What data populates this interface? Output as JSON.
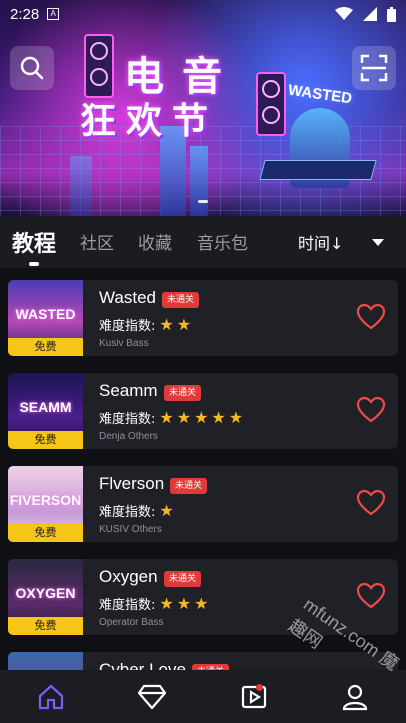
{
  "status_bar": {
    "time": "2:28",
    "notification_glyph": "A"
  },
  "banner": {
    "title_line1": "电音",
    "title_line2": "狂欢节",
    "sign_text": "WASTED",
    "dots_count": 1
  },
  "tabs": [
    {
      "label": "教程",
      "active": true
    },
    {
      "label": "社区",
      "active": false
    },
    {
      "label": "收藏",
      "active": false
    },
    {
      "label": "音乐包",
      "active": false
    }
  ],
  "sort": {
    "label": "时间↓"
  },
  "songs": [
    {
      "thumb_text": "WASTED",
      "free_label": "免费",
      "title": "Wasted",
      "badge": "未通关",
      "difficulty_label": "难度指数:",
      "stars": 2,
      "artist": "Kusiv",
      "genre": "Bass",
      "thumb_bg": "linear-gradient(180deg,#4b3bb5,#b54ab4 55%,#2a2470)"
    },
    {
      "thumb_text": "SEAMM",
      "free_label": "免费",
      "title": "Seamm",
      "badge": "未通关",
      "difficulty_label": "难度指数:",
      "stars": 5,
      "artist": "Denja",
      "genre": "Others",
      "thumb_bg": "linear-gradient(180deg,#1b1555,#4a1f8a 60%,#20124a)"
    },
    {
      "thumb_text": "FIVERSON",
      "free_label": "免费",
      "title": "Flverson",
      "badge": "未通关",
      "difficulty_label": "难度指数:",
      "stars": 1,
      "artist": "KUSIV",
      "genre": "Others",
      "thumb_bg": "linear-gradient(180deg,#f0d0e8,#c79bd8 60%,#e7c6e6)"
    },
    {
      "thumb_text": "OXYGEN",
      "free_label": "免费",
      "title": "Oxygen",
      "badge": "未通关",
      "difficulty_label": "难度指数:",
      "stars": 3,
      "artist": "Operator",
      "genre": "Bass",
      "thumb_bg": "linear-gradient(180deg,#2a2840,#5a2a6a 60%,#1c1b2a)"
    },
    {
      "thumb_text": "",
      "free_label": "",
      "title": "Cyber Love",
      "badge": "未通关",
      "difficulty_label": "",
      "stars": 0,
      "artist": "",
      "genre": "",
      "thumb_bg": "linear-gradient(180deg,#3a6aa8,#7a2a8a)"
    }
  ],
  "bottom_nav": [
    {
      "icon": "home-icon",
      "active": true
    },
    {
      "icon": "diamond-icon",
      "active": false
    },
    {
      "icon": "play-video-icon",
      "active": false,
      "has_badge": true
    },
    {
      "icon": "profile-icon",
      "active": false
    }
  ],
  "watermark": "mfunz.com 魔趣网",
  "colors": {
    "accent": "#7c5cff",
    "badge": "#e03a3a",
    "star": "#f5b820",
    "free": "#f5c518",
    "heart": "#ef4b4b"
  }
}
